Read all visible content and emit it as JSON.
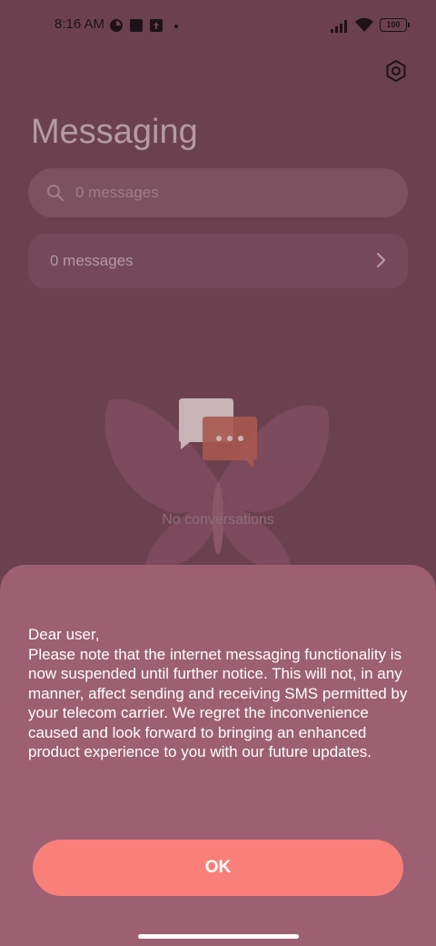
{
  "status_bar": {
    "time": "8:16 AM",
    "battery": "100",
    "icons": [
      "app-notification-icon",
      "square-notification-icon",
      "upload-notification-icon",
      "signal-icon",
      "wifi-icon",
      "battery-icon"
    ]
  },
  "header": {
    "title": "Messaging",
    "settings_icon": "settings-icon"
  },
  "search": {
    "placeholder": "0 messages"
  },
  "messages_row": {
    "label": "0 messages"
  },
  "empty_state": {
    "text": "No conversations"
  },
  "dialog": {
    "message": "Dear user,\nPlease note that the internet messaging functionality is now suspended until further notice. This will not, in any manner, affect sending and receiving SMS permitted by your telecom carrier. We regret the inconvenience caused and look forward to bringing an enhanced product experience to you with our future updates.",
    "ok_label": "OK"
  },
  "colors": {
    "background": "#6b4150",
    "sheet": "#9c6072",
    "ok_button": "#f97f79"
  }
}
